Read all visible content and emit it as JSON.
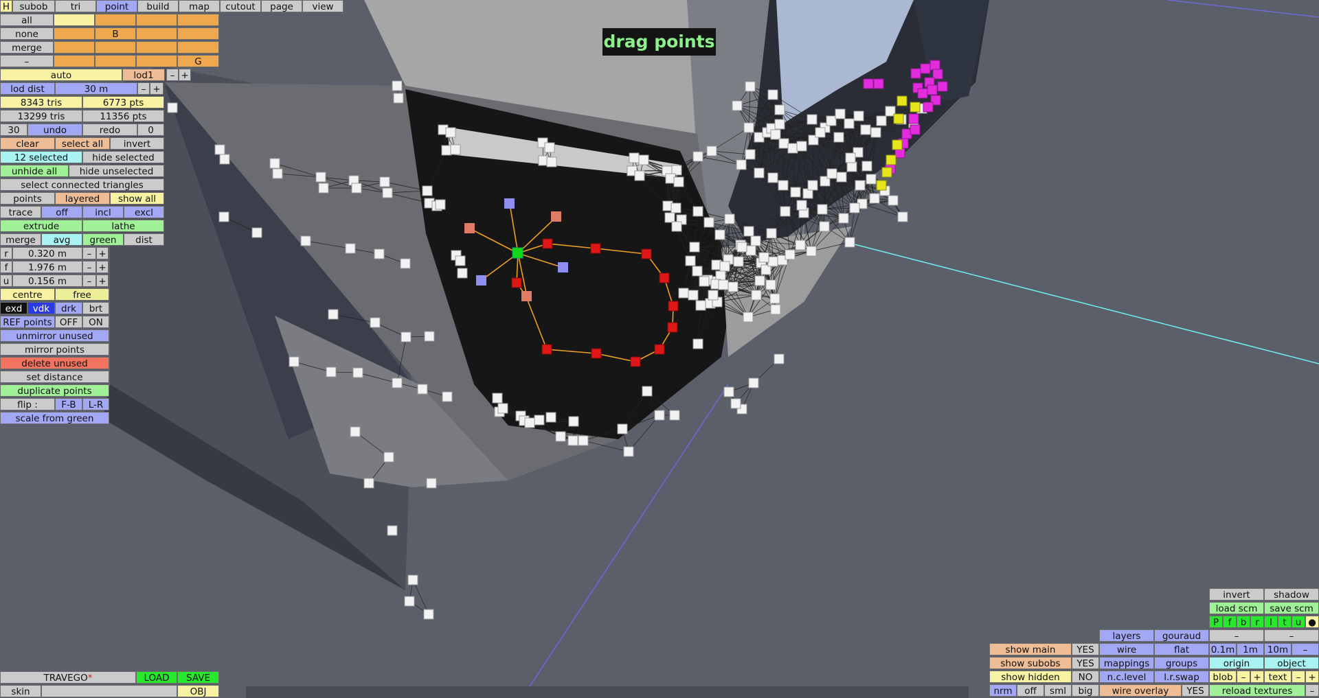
{
  "banner": "drag points",
  "menu_bar": {
    "items": [
      "H",
      "subob",
      "tri",
      "point",
      "build",
      "map",
      "cutout",
      "page",
      "view"
    ],
    "active": "point"
  },
  "layer_grid": {
    "rows": [
      "all",
      "none",
      "merge",
      "–"
    ],
    "cell_none": "B",
    "cell_dash": "G"
  },
  "lod": {
    "mode": "auto",
    "level": "lod1",
    "minus": "–",
    "plus": "+",
    "dist_label": "lod dist",
    "dist_value": "30 m"
  },
  "stats": {
    "tris_a": "8343 tris",
    "pts_a": "6773 pts",
    "tris_b": "13299 tris",
    "pts_b": "11356 pts"
  },
  "history": {
    "count": "30",
    "undo": "undo",
    "redo": "redo",
    "redo_count": "0"
  },
  "selection": {
    "clear": "clear",
    "select_all": "select all",
    "invert": "invert",
    "selected_count": "12 selected",
    "hide_selected": "hide selected",
    "unhide_all": "unhide all",
    "hide_unselected": "hide unselected",
    "select_connected": "select connected triangles"
  },
  "view_mode": {
    "points": "points",
    "layered": "layered",
    "show_all": "show all"
  },
  "trace": {
    "label": "trace",
    "off": "off",
    "incl": "incl",
    "excl": "excl"
  },
  "ops": {
    "extrude": "extrude",
    "lathe": "lathe",
    "merge": "merge",
    "avg": "avg",
    "green": "green",
    "dist": "dist"
  },
  "params": [
    {
      "label": "r",
      "value": "0.320 m"
    },
    {
      "label": "f",
      "value": "1.976 m"
    },
    {
      "label": "u",
      "value": "0.156 m"
    }
  ],
  "pivot": {
    "centre": "centre",
    "free": "free"
  },
  "shade": {
    "exd": "exd",
    "vdk": "vdk",
    "drk": "drk",
    "brt": "brt"
  },
  "ref_points": {
    "label": "REF points",
    "off": "OFF",
    "on": "ON"
  },
  "tools": {
    "unmirror_unused": "unmirror unused",
    "mirror_points": "mirror points",
    "delete_unused": "delete unused",
    "set_distance": "set distance",
    "duplicate_points": "duplicate points",
    "flip_label": "flip :",
    "flip_fb": "F-B",
    "flip_lr": "L-R",
    "scale_from_green": "scale from green"
  },
  "file": {
    "name": "TRAVEGO",
    "modified_mark": "*",
    "load": "LOAD",
    "save": "SAVE",
    "skin": "skin",
    "obj": "OBJ"
  },
  "right_panel": {
    "invert": "invert",
    "shadow": "shadow",
    "load_scm": "load scm",
    "save_scm": "save scm",
    "channels": [
      "P",
      "f",
      "b",
      "r",
      "l",
      "t",
      "u",
      "●"
    ],
    "dash": "–",
    "layers": "layers",
    "gouraud": "gouraud",
    "show_main": "show main",
    "show_main_v": "YES",
    "show_subobs": "show subobs",
    "show_subobs_v": "YES",
    "show_hidden": "show hidden",
    "show_hidden_v": "NO",
    "wire": "wire",
    "flat": "flat",
    "mappings": "mappings",
    "groups": "groups",
    "nc_level": "n.c.level",
    "lr_swap": "l.r.swap",
    "grid": [
      "0.1m",
      "1m",
      "10m",
      "–"
    ],
    "origin": "origin",
    "object": "object",
    "blob": "blob",
    "text": "text",
    "nrm": "nrm",
    "off": "off",
    "sml": "sml",
    "big": "big",
    "wire_overlay": "wire overlay",
    "wire_overlay_v": "YES",
    "reload_textures": "reload textures",
    "minus": "–",
    "plus": "+"
  }
}
